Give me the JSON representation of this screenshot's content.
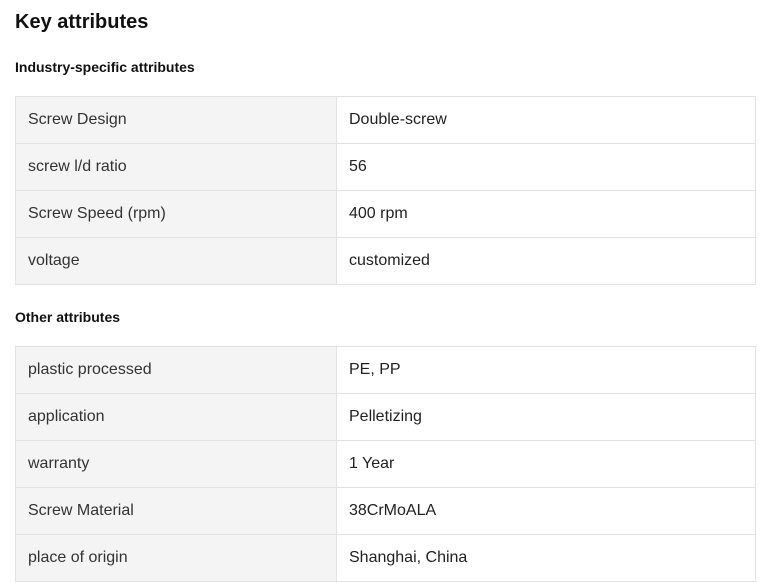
{
  "page": {
    "title": "Key attributes"
  },
  "sections": [
    {
      "title": "Industry-specific attributes",
      "rows": [
        {
          "name": "Screw Design",
          "value": "Double-screw"
        },
        {
          "name": "screw l/d ratio",
          "value": "56"
        },
        {
          "name": "Screw Speed (rpm)",
          "value": "400 rpm"
        },
        {
          "name": "voltage",
          "value": "customized"
        }
      ]
    },
    {
      "title": "Other attributes",
      "rows": [
        {
          "name": "plastic processed",
          "value": "PE, PP"
        },
        {
          "name": "application",
          "value": "Pelletizing"
        },
        {
          "name": "warranty",
          "value": "1 Year"
        },
        {
          "name": "Screw Material",
          "value": "38CrMoALA"
        },
        {
          "name": "place of origin",
          "value": "Shanghai, China"
        }
      ]
    }
  ]
}
